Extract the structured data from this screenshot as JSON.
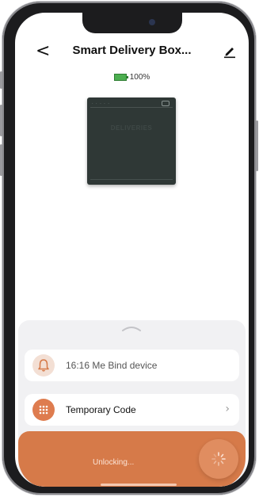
{
  "header": {
    "back_glyph": "<",
    "title": "Smart Delivery Box...",
    "edit_icon": "pencil-icon"
  },
  "battery": {
    "level_text": "100%",
    "level_fraction": 1.0,
    "color": "#4caf50"
  },
  "device": {
    "box_label": "DELIVERIES",
    "color": "#2f3836"
  },
  "panel": {
    "log_entry": "16:16 Me  Bind device",
    "log_icon": "bell-icon",
    "temp_code_label": "Temporary Code",
    "temp_code_icon": "keypad-icon",
    "chevron": "›"
  },
  "unlock": {
    "status_text": "Unlocking...",
    "accent_color": "#d67a49",
    "spinner_icon": "spinner-icon"
  }
}
